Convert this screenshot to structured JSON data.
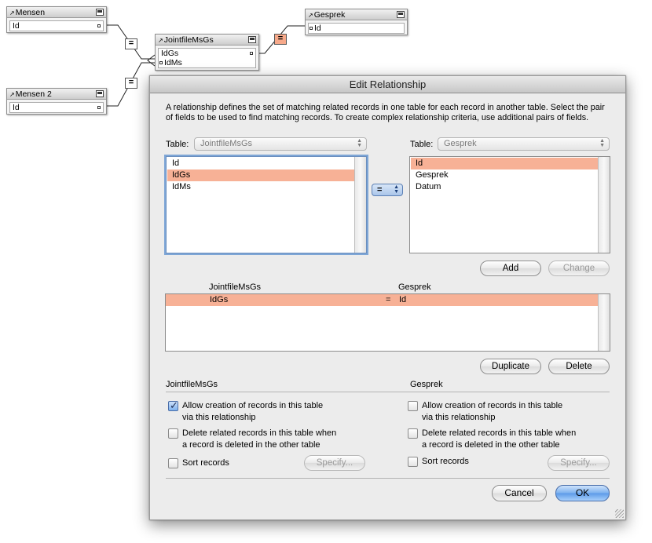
{
  "graph": {
    "mensen": {
      "title": "Mensen",
      "fields": [
        "Id"
      ]
    },
    "mensen2": {
      "title": "Mensen 2",
      "fields": [
        "Id"
      ]
    },
    "jointfile": {
      "title": "JointfileMsGs",
      "fields": [
        "IdGs",
        "IdMs"
      ]
    },
    "gesprek": {
      "title": "Gesprek",
      "fields": [
        "Id"
      ]
    },
    "relation_symbol": "="
  },
  "dialog": {
    "title": "Edit Relationship",
    "description": "A relationship defines the set of matching related records in one table for each record in another table. Select the pair of fields to be used to find matching records. To create complex relationship criteria, use additional pairs of fields.",
    "left_table": {
      "label": "Table:",
      "value": "JointfileMsGs",
      "fields": [
        "Id",
        "IdGs",
        "IdMs"
      ],
      "selected": "IdGs"
    },
    "right_table": {
      "label": "Table:",
      "value": "Gesprek",
      "fields": [
        "Id",
        "Gesprek",
        "Datum"
      ],
      "selected": "Id"
    },
    "operator": "=",
    "buttons": {
      "add": "Add",
      "change": "Change",
      "duplicate": "Duplicate",
      "delete": "Delete",
      "cancel": "Cancel",
      "ok": "OK"
    },
    "criteria": {
      "left_header": "JointfileMsGs",
      "right_header": "Gesprek",
      "rows": [
        {
          "left": "IdGs",
          "op": "=",
          "right": "Id"
        }
      ]
    },
    "left_options": {
      "header": "JointfileMsGs",
      "allow_creation": "Allow creation of records in this table via this relationship",
      "allow_creation_line1": "Allow creation of records in this table",
      "allow_creation_line2": "via this relationship",
      "allow_creation_checked": true,
      "delete_related_line1": "Delete related records in this table when",
      "delete_related_line2": "a record is deleted in the other table",
      "delete_related_checked": false,
      "sort_records": "Sort records",
      "sort_records_checked": false,
      "specify": "Specify..."
    },
    "right_options": {
      "header": "Gesprek",
      "allow_creation_line1": "Allow creation of records in this table",
      "allow_creation_line2": "via this relationship",
      "allow_creation_checked": false,
      "delete_related_line1": "Delete related records in this table when",
      "delete_related_line2": "a record is deleted in the other table",
      "delete_related_checked": false,
      "sort_records": "Sort records",
      "sort_records_checked": false,
      "specify": "Specify..."
    }
  },
  "colors": {
    "selection": "#f7b196",
    "relation_selected": "#f7a98a",
    "default_button": "#5b99e8"
  }
}
